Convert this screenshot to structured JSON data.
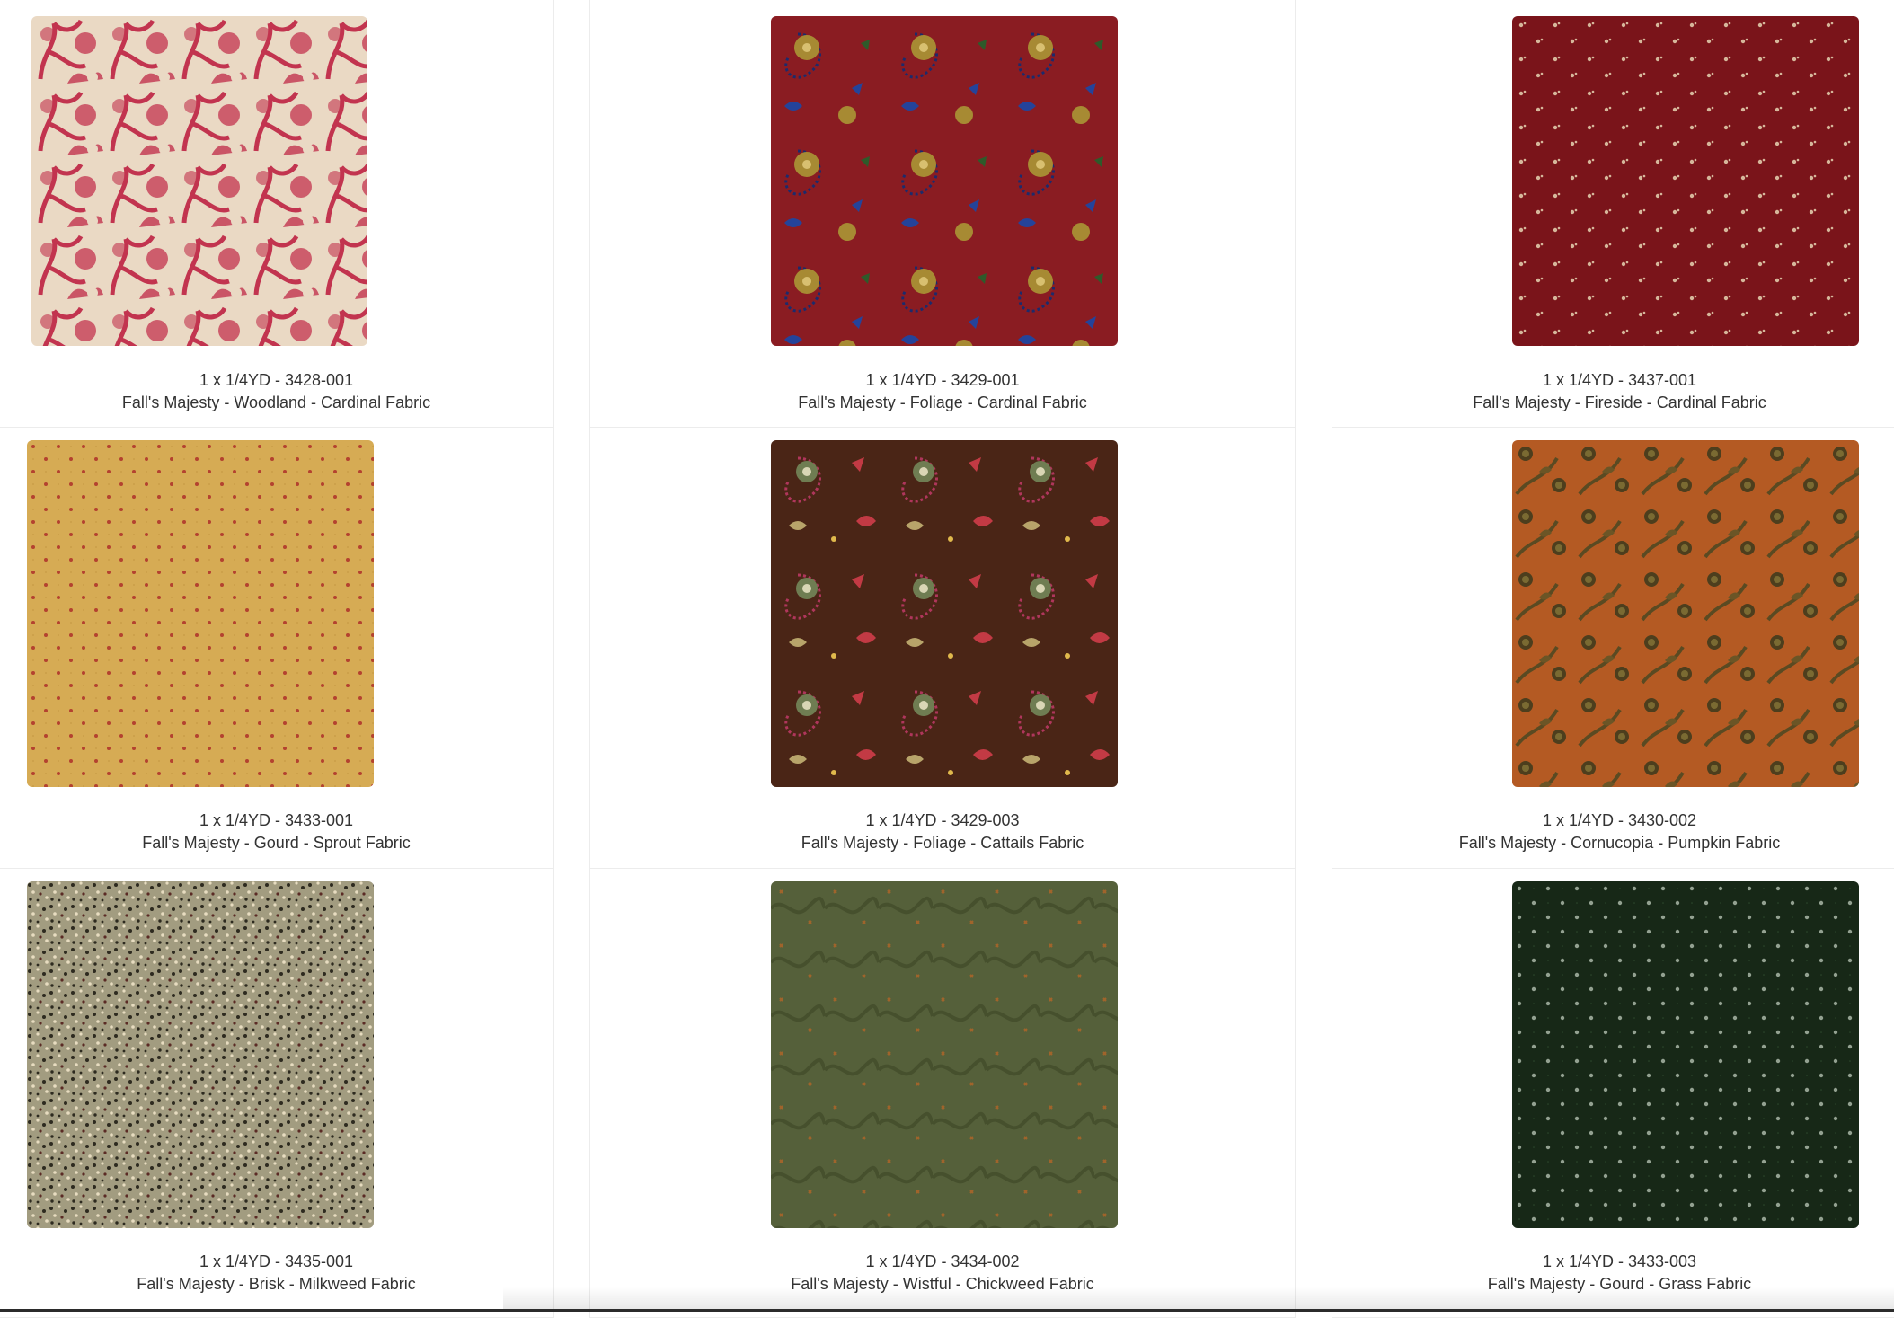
{
  "products": [
    {
      "sku": "1 x 1/4YD - 3428-001",
      "name": "Fall's Majesty - Woodland - Cardinal Fabric",
      "swatch_colors": [
        "#ead9c4",
        "#c2344f"
      ],
      "swatch_icon": "toile-pattern-icon"
    },
    {
      "sku": "1 x 1/4YD - 3429-001",
      "name": "Fall's Majesty - Foliage - Cardinal Fabric",
      "swatch_colors": [
        "#8a1c22",
        "#a78a33",
        "#24439a"
      ],
      "swatch_icon": "paisley-pattern-icon"
    },
    {
      "sku": "1 x 1/4YD - 3437-001",
      "name": "Fall's Majesty - Fireside - Cardinal Fabric",
      "swatch_colors": [
        "#7a141a",
        "#d6b79b"
      ],
      "swatch_icon": "sprig-dot-pattern-icon"
    },
    {
      "sku": "1 x 1/4YD - 3433-001",
      "name": "Fall's Majesty - Gourd - Sprout Fabric",
      "swatch_colors": [
        "#d6ab54",
        "#b4422f"
      ],
      "swatch_icon": "pin-dot-pattern-icon"
    },
    {
      "sku": "1 x 1/4YD - 3429-003",
      "name": "Fall's Majesty - Foliage - Cattails Fabric",
      "swatch_colors": [
        "#4a2516",
        "#c23a44",
        "#b8a46a"
      ],
      "swatch_icon": "paisley-pattern-icon"
    },
    {
      "sku": "1 x 1/4YD - 3430-002",
      "name": "Fall's Majesty - Cornucopia - Pumpkin Fabric",
      "swatch_colors": [
        "#b45a23",
        "#4d3e1d"
      ],
      "swatch_icon": "berry-vine-pattern-icon"
    },
    {
      "sku": "1 x 1/4YD - 3435-001",
      "name": "Fall's Majesty - Brisk - Milkweed Fabric",
      "swatch_colors": [
        "#a29c80",
        "#2d2a1f",
        "#e7dcc0"
      ],
      "swatch_icon": "speckle-pattern-icon"
    },
    {
      "sku": "1 x 1/4YD - 3434-002",
      "name": "Fall's Majesty - Wistful - Chickweed Fabric",
      "swatch_colors": [
        "#55603a",
        "#a0642b"
      ],
      "swatch_icon": "vine-pattern-icon"
    },
    {
      "sku": "1 x 1/4YD - 3433-003",
      "name": "Fall's Majesty - Gourd - Grass Fabric",
      "swatch_colors": [
        "#172817",
        "#93a191"
      ],
      "swatch_icon": "pin-dot-pattern-icon"
    }
  ]
}
